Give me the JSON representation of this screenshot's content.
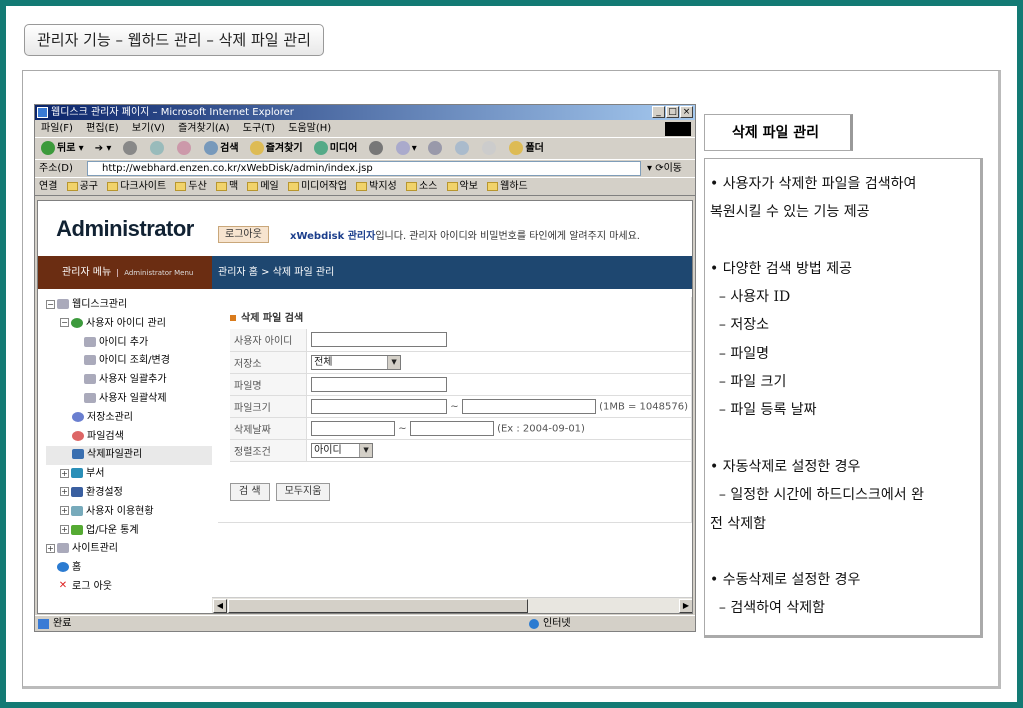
{
  "slide_title": "관리자 기능 – 웹하드 관리 – 삭제 파일 관리",
  "browser": {
    "title": "웹디스크 관리자 페이지 – Microsoft Internet Explorer",
    "window_buttons": [
      "_",
      "□",
      "×"
    ],
    "menus": [
      "파일(F)",
      "편집(E)",
      "보기(V)",
      "즐겨찾기(A)",
      "도구(T)",
      "도움말(H)"
    ],
    "toolbar": [
      "뒤로",
      "검색",
      "즐겨찾기",
      "미디어",
      "폴더"
    ],
    "address_label": "주소(D)",
    "address_url": "http://webhard.enzen.co.kr/xWebDisk/admin/index.jsp",
    "go_label": "이동",
    "links_label": "연결",
    "links": [
      "공구",
      "다크사이트",
      "두산",
      "맥",
      "메일",
      "미디어작업",
      "박지성",
      "소스",
      "악보",
      "웹하드"
    ],
    "status": "완료",
    "zone": "인터넷"
  },
  "admin": {
    "logo": "Administrator",
    "logout": "로그아웃",
    "welcome_bold": "xWebdisk 관리자",
    "welcome_rest": "입니다. 관리자 아이디와 비밀번호를 타인에게 알려주지 마세요.",
    "menu_header": "관리자 메뉴",
    "menu_header_small": "Administrator Menu",
    "breadcrumb": "관리자 홈 > 삭제 파일 관리",
    "tree": [
      "웹디스크관리",
      "사용자 아이디 관리",
      "아이디 추가",
      "아이디 조회/변경",
      "사용자 일괄추가",
      "사용자 일괄삭제",
      "저장소관리",
      "파일검색",
      "삭제파일관리",
      "부서",
      "환경설정",
      "사용자 이용현황",
      "업/다운 통계",
      "사이트관리",
      "홈",
      "로그 아웃"
    ],
    "form": {
      "title": "삭제 파일 검색",
      "user_id": "사용자 아이디",
      "storage": "저장소",
      "storage_value": "전체",
      "filename": "파일명",
      "filesize": "파일크기",
      "size_note": "(1MB = 1048576)",
      "deleted_date": "삭제날짜",
      "date_note": "(Ex : 2004-09-01)",
      "sort": "정렬조건",
      "sort_value": "아이디",
      "range_sep": "~",
      "search_btn": "검  색",
      "reset_btn": "모두지움"
    }
  },
  "side": {
    "tab": "삭제 파일 관리",
    "lines": [
      "• 사용자가 삭제한 파일을 검색하여",
      "복원시킬 수 있는 기능 제공",
      "",
      "• 다양한 검색 방법 제공",
      "  – 사용자 ID",
      "  – 저장소",
      "  – 파일명",
      "  – 파일 크기",
      "  – 파일 등록 날짜",
      "",
      "• 자동삭제로 설정한 경우",
      "  – 일정한 시간에 하드디스크에서 완",
      "전 삭제함",
      "",
      "• 수동삭제로 설정한 경우",
      "  – 검색하여 삭제함"
    ]
  }
}
